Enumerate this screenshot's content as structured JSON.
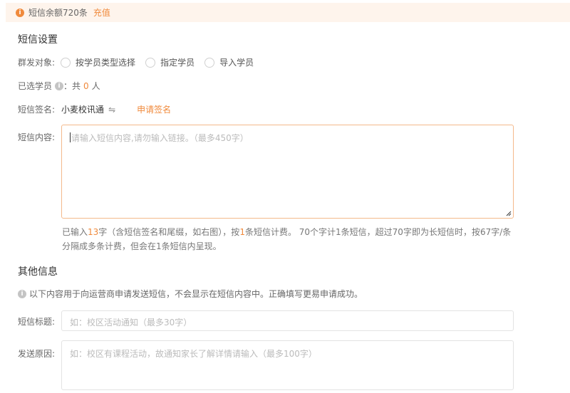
{
  "notice": {
    "balance_text": "短信余额720条",
    "recharge_label": "充值",
    "icon": "info-icon"
  },
  "sms_settings": {
    "title": "短信设置",
    "target_label": "群发对象:",
    "target_options": [
      "按学员类型选择",
      "指定学员",
      "导入学员"
    ],
    "selected_label": "已选学员",
    "selected_prefix": "：共",
    "selected_count": "0",
    "selected_suffix": "人",
    "signature_label": "短信签名:",
    "signature_value": "小麦校讯通",
    "apply_signature_label": "申请签名",
    "content_label": "短信内容:",
    "content_placeholder": "请输入短信内容,请勿输入链接。（最多450字）",
    "hint_part1": "已输入",
    "hint_count": "13",
    "hint_part2": "字（含短信签名和尾缀，如右图），按",
    "hint_one": "1",
    "hint_part3": "条短信计费。 70个字计1条短信，超过70字即为长短信时，按67字/条分隔成多条计费，但会在1条短信内呈现。"
  },
  "other_info": {
    "title": "其他信息",
    "notice": "以下内容用于向运营商申请发送短信，不会显示在短信内容中。正确填写更易申请成功。",
    "sms_title_label": "短信标题:",
    "sms_title_placeholder": "如：校区活动通知（最多30字）",
    "reason_label": "发送原因:",
    "reason_placeholder": "如：校区有课程活动，故通知家长了解详情请输入（最多100字）"
  },
  "colors": {
    "accent": "#f08a3c",
    "notice_bg": "#fef4ec"
  }
}
